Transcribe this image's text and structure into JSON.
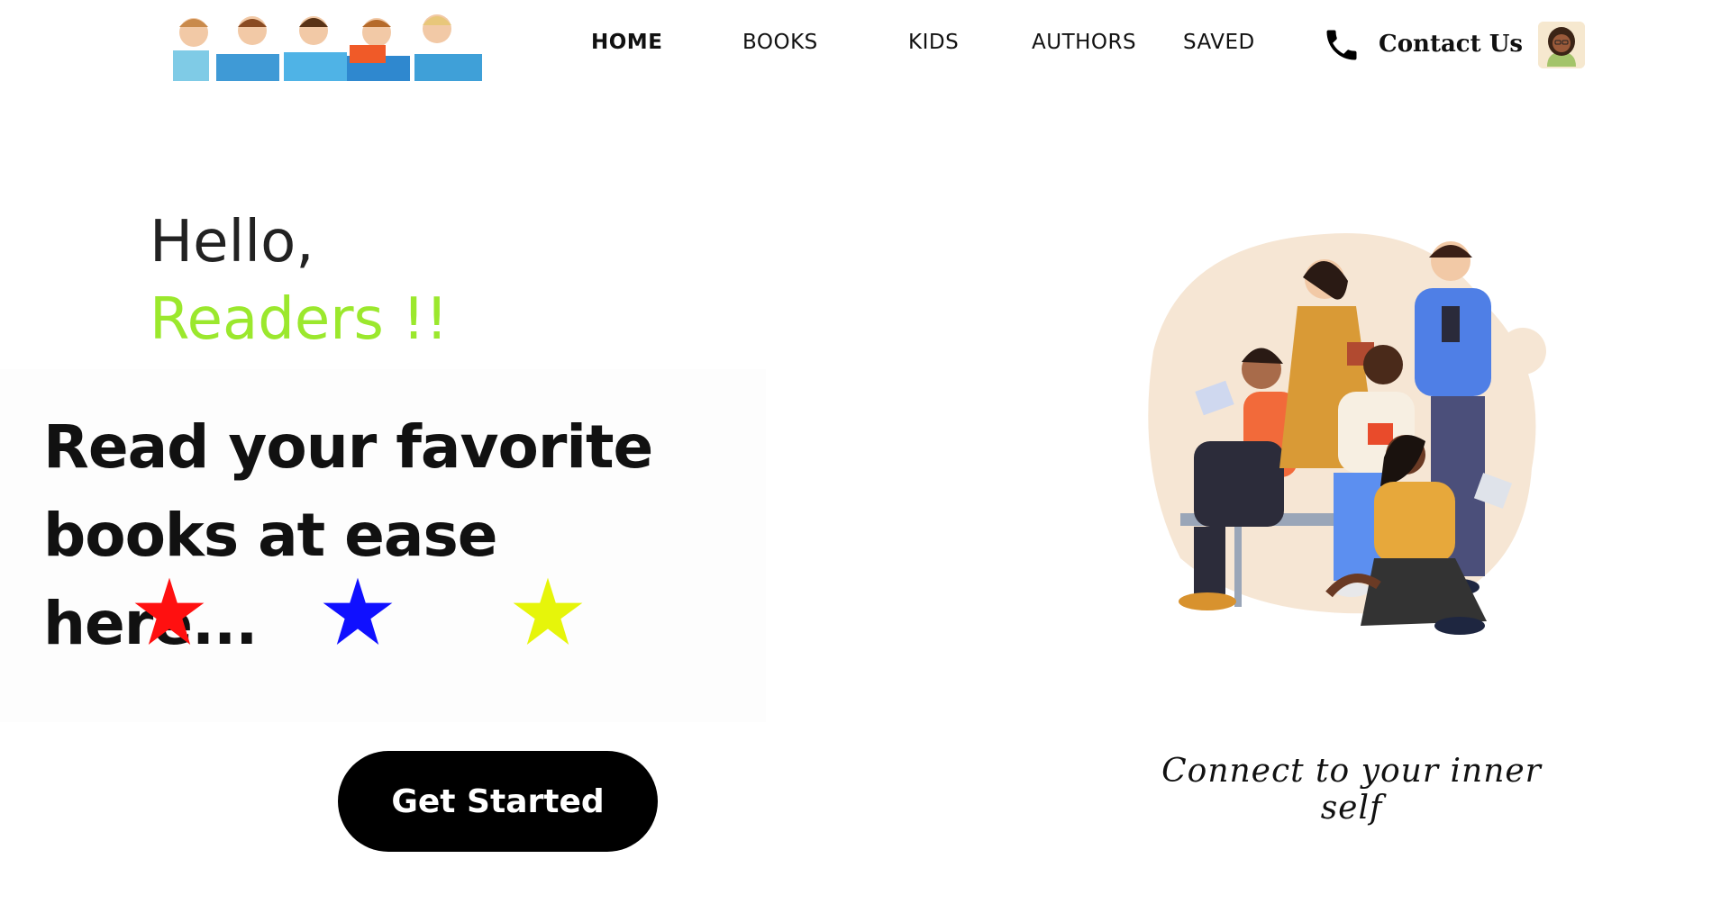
{
  "header": {
    "logo_alt": "Kids reading books",
    "nav": [
      {
        "label": "HOME",
        "active": true
      },
      {
        "label": "BOOKS",
        "active": false
      },
      {
        "label": "KIDS",
        "active": false
      },
      {
        "label": "AUTHORS",
        "active": false
      },
      {
        "label": "SAVED",
        "active": false
      }
    ],
    "contact_label": "Contact Us",
    "phone_icon": "phone-icon",
    "avatar_icon": "user-avatar"
  },
  "hero": {
    "greeting": "Hello,",
    "readers": "Readers !!",
    "tagline": "Read your favorite books at ease here...",
    "stars": [
      {
        "color": "#ff1010"
      },
      {
        "color": "#1010ff"
      },
      {
        "color": "#e6f50a"
      }
    ],
    "cta_label": "Get Started",
    "caption": "Connect to your inner self"
  },
  "colors": {
    "accent_green": "#9be82d",
    "cta_bg": "#000000",
    "blob": "#f6e6d4"
  }
}
